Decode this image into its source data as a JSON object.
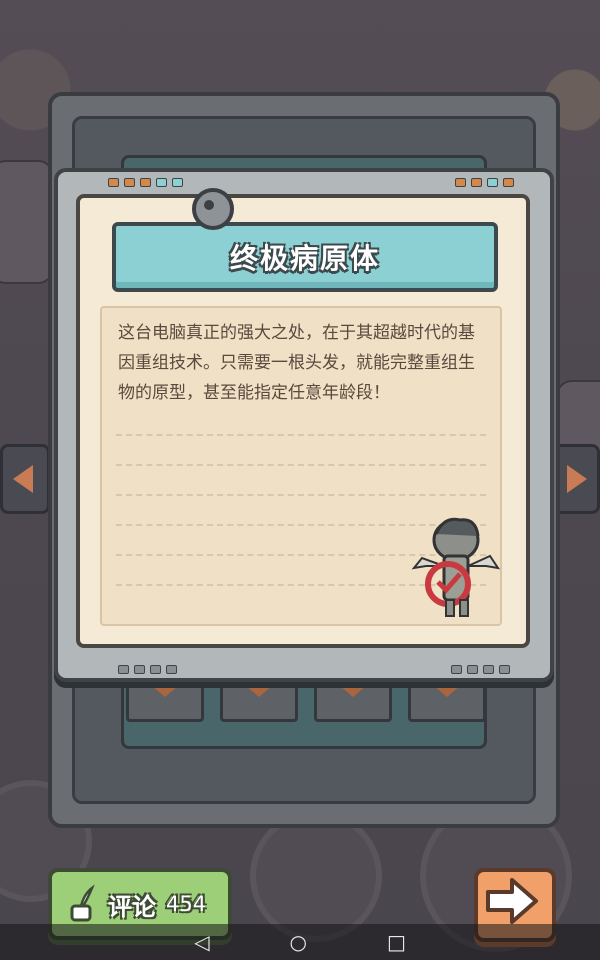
{
  "colors": {
    "title_banner": "#8dd0d3",
    "paper": "#f5ead6",
    "comment_button": "#9ccf78",
    "next_button": "#f0a068",
    "stamp_red": "#c83a40"
  },
  "card": {
    "title": "终极病原体",
    "description": "这台电脑真正的强大之处，在于其超越时代的基因重组技术。只需要一根头发，就能完整重组生物的原型，甚至能指定任意年龄段！",
    "stamp_icon": "zombie-character-rejected-stamp"
  },
  "bottom_bar": {
    "comment_label": "评论",
    "comment_count": "454",
    "comment_icon": "quill-inkpot-icon",
    "next_icon": "arrow-right-icon"
  },
  "system_nav": {
    "back_icon": "◁",
    "home_icon": "○",
    "recents_icon": "□"
  }
}
